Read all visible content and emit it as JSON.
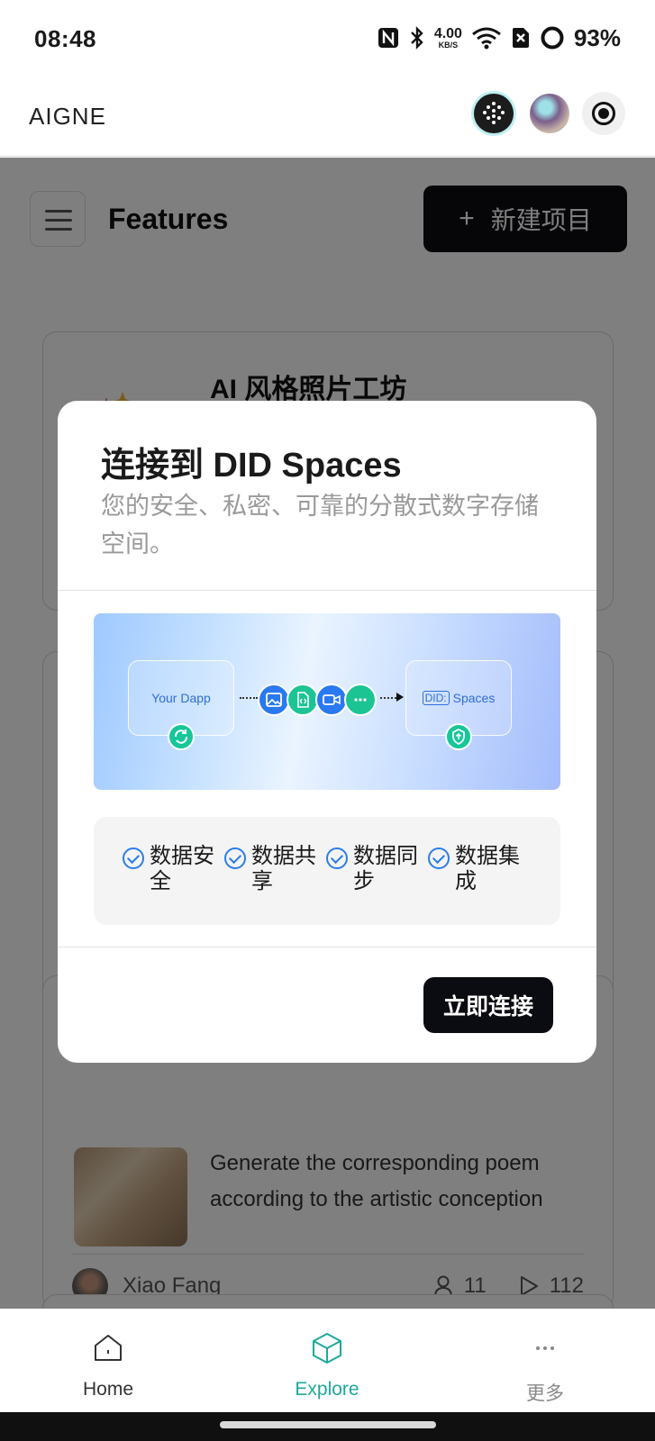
{
  "status_bar": {
    "time": "08:48",
    "net_speed_value": "4.00",
    "net_speed_unit": "KB/S",
    "battery": "93%"
  },
  "header": {
    "brand": "AIGNE"
  },
  "page": {
    "title": "Features",
    "new_project_label": "新建项目",
    "card1_title": "AI 风格照片工坊",
    "card3_description": "Generate the corresponding poem according to the artistic conception",
    "card3_author": "Xiao Fang",
    "card3_users": "11",
    "card3_runs": "112"
  },
  "dialog": {
    "title": "连接到 DID Spaces",
    "subtitle": "您的安全、私密、可靠的分散式数字存储空间。",
    "banner": {
      "left_box": "Your Dapp",
      "right_box_prefix": "DID:",
      "right_box": "Spaces"
    },
    "features": [
      "数据安全",
      "数据共享",
      "数据同步",
      "数据集成"
    ],
    "connect_label": "立即连接"
  },
  "bottom_nav": {
    "items": [
      {
        "label": "Home",
        "icon": "home-icon"
      },
      {
        "label": "Explore",
        "icon": "cube-icon",
        "active": true
      },
      {
        "label": "更多",
        "icon": "more-icon"
      }
    ],
    "active_color": "#1ea89b"
  },
  "colors": {
    "accent": "#1ea89b",
    "primary_button": "#0b0b12",
    "check_blue": "#2b7de9"
  }
}
